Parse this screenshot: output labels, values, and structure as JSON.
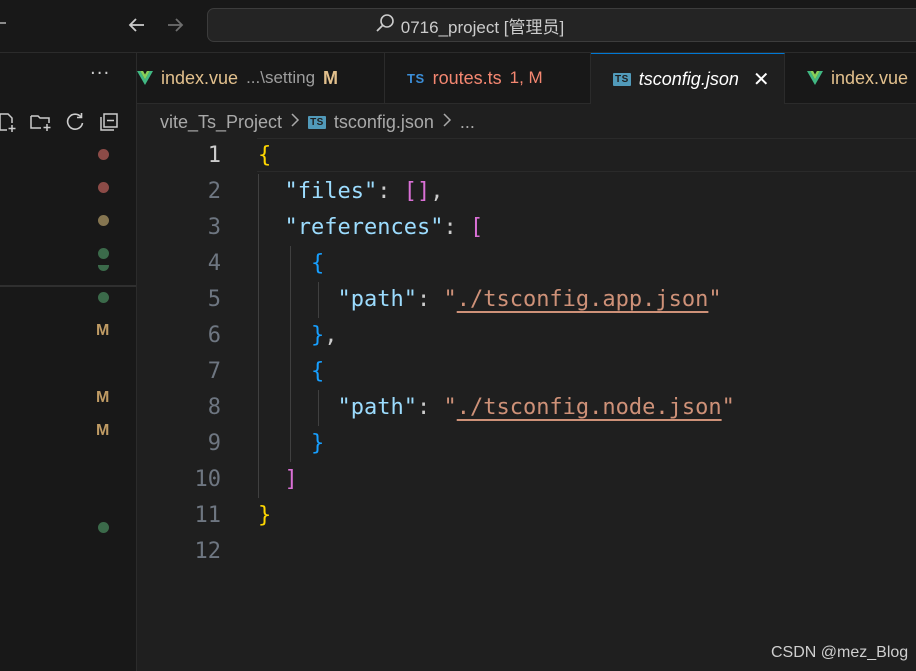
{
  "titlebar": {
    "search_text": "0716_project [管理员]"
  },
  "sidebar": {
    "more_label": "···",
    "badges": [
      "M",
      "M",
      "M"
    ],
    "colors": {
      "red_dot": "#8c4b47",
      "olive_dot": "#857550",
      "green_dot": "#3b6a4a",
      "m_badge": "#bf9b64"
    }
  },
  "tabs": [
    {
      "name": "index.vue",
      "desc": "...\\setting",
      "status": "M",
      "icon": "vue-icon"
    },
    {
      "name": "routes.ts",
      "status": "1, M",
      "icon": "ts-icon"
    },
    {
      "name": "tsconfig.json",
      "active": true,
      "icon": "ts-icon",
      "close": "✕"
    },
    {
      "name": "index.vue",
      "icon": "vue-icon"
    }
  ],
  "breadcrumb": {
    "project": "vite_Ts_Project",
    "file": "tsconfig.json",
    "more": "..."
  },
  "editor": {
    "line_numbers": [
      "1",
      "2",
      "3",
      "4",
      "5",
      "6",
      "7",
      "8",
      "9",
      "10",
      "11",
      "12"
    ],
    "tokens": {
      "open_brace": "{",
      "close_brace": "}",
      "files_key": "\"files\"",
      "references_key": "\"references\"",
      "path_key": "\"path\"",
      "colon": ": ",
      "comma": ",",
      "empty_array": "[]",
      "open_bracket": "[",
      "close_bracket": "]",
      "quote": "\"",
      "app_path": "./tsconfig.app.json",
      "node_path": "./tsconfig.node.json"
    }
  },
  "watermark": "CSDN @mez_Blog"
}
